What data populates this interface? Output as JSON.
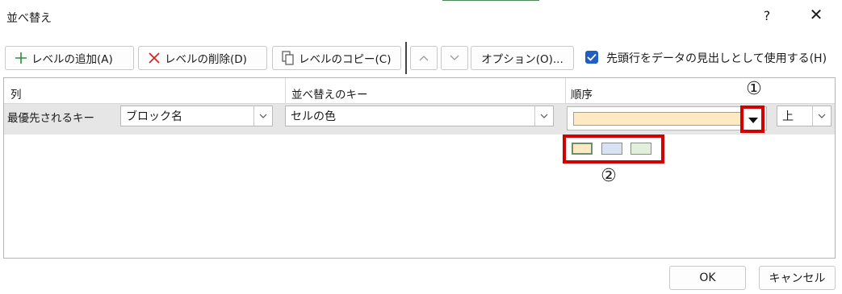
{
  "dialog": {
    "title": "並べ替え",
    "help": "?",
    "close": "✕"
  },
  "toolbar": {
    "add_level": "レベルの追加(A)",
    "delete_level": "レベルの削除(D)",
    "copy_level": "レベルのコピー(C)",
    "options": "オプション(O)...",
    "header_checkbox_label": "先頭行をデータの見出しとして使用する(H)",
    "header_checkbox_checked": true
  },
  "grid": {
    "headers": {
      "column": "列",
      "sort_key": "並べ替えのキー",
      "order": "順序"
    },
    "row": {
      "label": "最優先されるキー",
      "column_value": "ブロック名",
      "sort_key_value": "セルの色",
      "order_position": "上",
      "selected_color": "#ffe9c3"
    }
  },
  "palette": {
    "colors": [
      "#ffe9c3",
      "#d9e2f3",
      "#e2efda"
    ]
  },
  "annotations": {
    "marker1": "①",
    "marker2": "②",
    "highlight_color": "#d40000"
  },
  "footer": {
    "ok": "OK",
    "cancel": "キャンセル"
  }
}
